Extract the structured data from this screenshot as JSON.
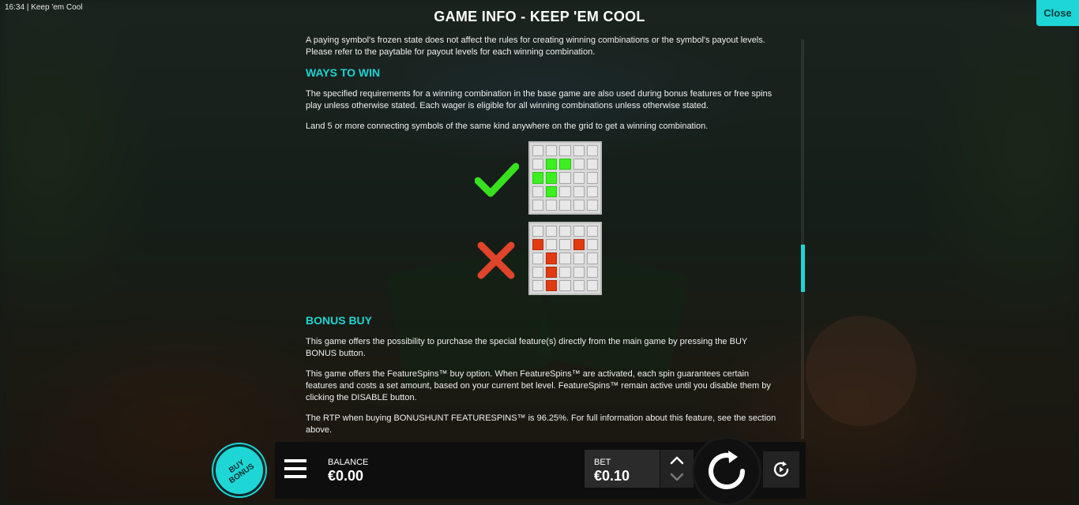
{
  "status_bar": {
    "time": "16:34",
    "app_title": "Keep 'em Cool"
  },
  "header": {
    "title": "GAME INFO - KEEP 'EM COOL",
    "close_label": "Close"
  },
  "content": {
    "intro_text": "A paying symbol's frozen state does not affect the rules for creating winning combinations or the symbol's payout levels. Please refer to the paytable for payout levels for each winning combination.",
    "ways_to_win": {
      "heading": "WAYS TO WIN",
      "paragraph_1": "The specified requirements for a winning combination in the base game are also used during bonus features or free spins play unless otherwise stated. Each wager is eligible for all winning combinations unless otherwise stated.",
      "paragraph_2": "Land 5 or more connecting symbols of the same kind anywhere on the grid to get a winning combination.",
      "valid_example_cells": [
        [
          1,
          1
        ],
        [
          1,
          2
        ],
        [
          2,
          0
        ],
        [
          2,
          1
        ],
        [
          3,
          1
        ]
      ],
      "invalid_example_cells": [
        [
          1,
          0
        ],
        [
          1,
          3
        ],
        [
          2,
          1
        ],
        [
          3,
          1
        ],
        [
          4,
          1
        ]
      ]
    },
    "bonus_buy": {
      "heading": "BONUS BUY",
      "paragraph_1": "This game offers the possibility to purchase the special feature(s) directly from the main game by pressing the BUY BONUS button.",
      "paragraph_2": "This game offers the FeatureSpins™ buy option. When FeatureSpins™ are activated, each spin guarantees certain features and costs a set amount, based on your current bet level. FeatureSpins™ remain active until you disable them by clicking the DISABLE button.",
      "paragraph_3": "The RTP when buying BONUSHUNT FEATURESPINS™ is 96.25%. For full information about this feature, see the section above."
    }
  },
  "controls": {
    "buy_bonus_label": "BUY BONUS",
    "balance_label": "BALANCE",
    "balance_value": "€0.00",
    "bet_label": "BET",
    "bet_value": "€0.10"
  },
  "colors": {
    "accent": "#1ed6d6",
    "valid_cell": "#3cf01f",
    "invalid_cell": "#e23b12",
    "check_mark": "#39e01f",
    "cross_mark": "#e0442a"
  }
}
